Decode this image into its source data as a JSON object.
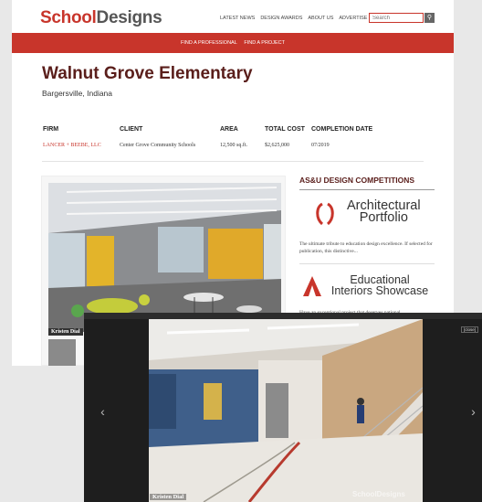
{
  "header": {
    "logo_school": "School",
    "logo_designs": "Designs",
    "nav": [
      "LATEST NEWS",
      "DESIGN AWARDS",
      "ABOUT US",
      "ADVERTISE"
    ],
    "search_placeholder": "Search",
    "search_icon": "search-icon"
  },
  "subnav": [
    "FIND A PROFESSIONAL",
    "FIND A PROJECT"
  ],
  "project": {
    "title": "Walnut Grove Elementary",
    "location": "Bargersville, Indiana"
  },
  "facts": {
    "firm_label": "FIRM",
    "firm_value": "LANCER + BEEBE, LLC",
    "client_label": "CLIENT",
    "client_value": "Center Grove Community Schools",
    "area_label": "AREA",
    "area_value": "12,500 sq.ft.",
    "cost_label": "TOTAL COST",
    "cost_value": "$2,625,000",
    "date_label": "COMPLETION DATE",
    "date_value": "07/2019"
  },
  "gallery": {
    "credit": "Kristen Dial"
  },
  "sidebar": {
    "title": "AS&U DESIGN COMPETITIONS",
    "brand1_line1": "Architectural",
    "brand1_line2": "Portfolio",
    "brand1_text": "The ultimate tribute to education design excellence. If selected for publication, this distinctive...",
    "brand2_line1": "Educational",
    "brand2_line2": "Interiors Showcase",
    "brand2_text": "Have an exceptional project that deserves national"
  },
  "lightbox": {
    "close_label": "[close]",
    "prev_glyph": "‹",
    "next_glyph": "›",
    "credit": "Kristen Dial",
    "watermark": "SchoolDesigns"
  },
  "colors": {
    "brand_red": "#c8352b",
    "title_maroon": "#5a1e1b"
  }
}
